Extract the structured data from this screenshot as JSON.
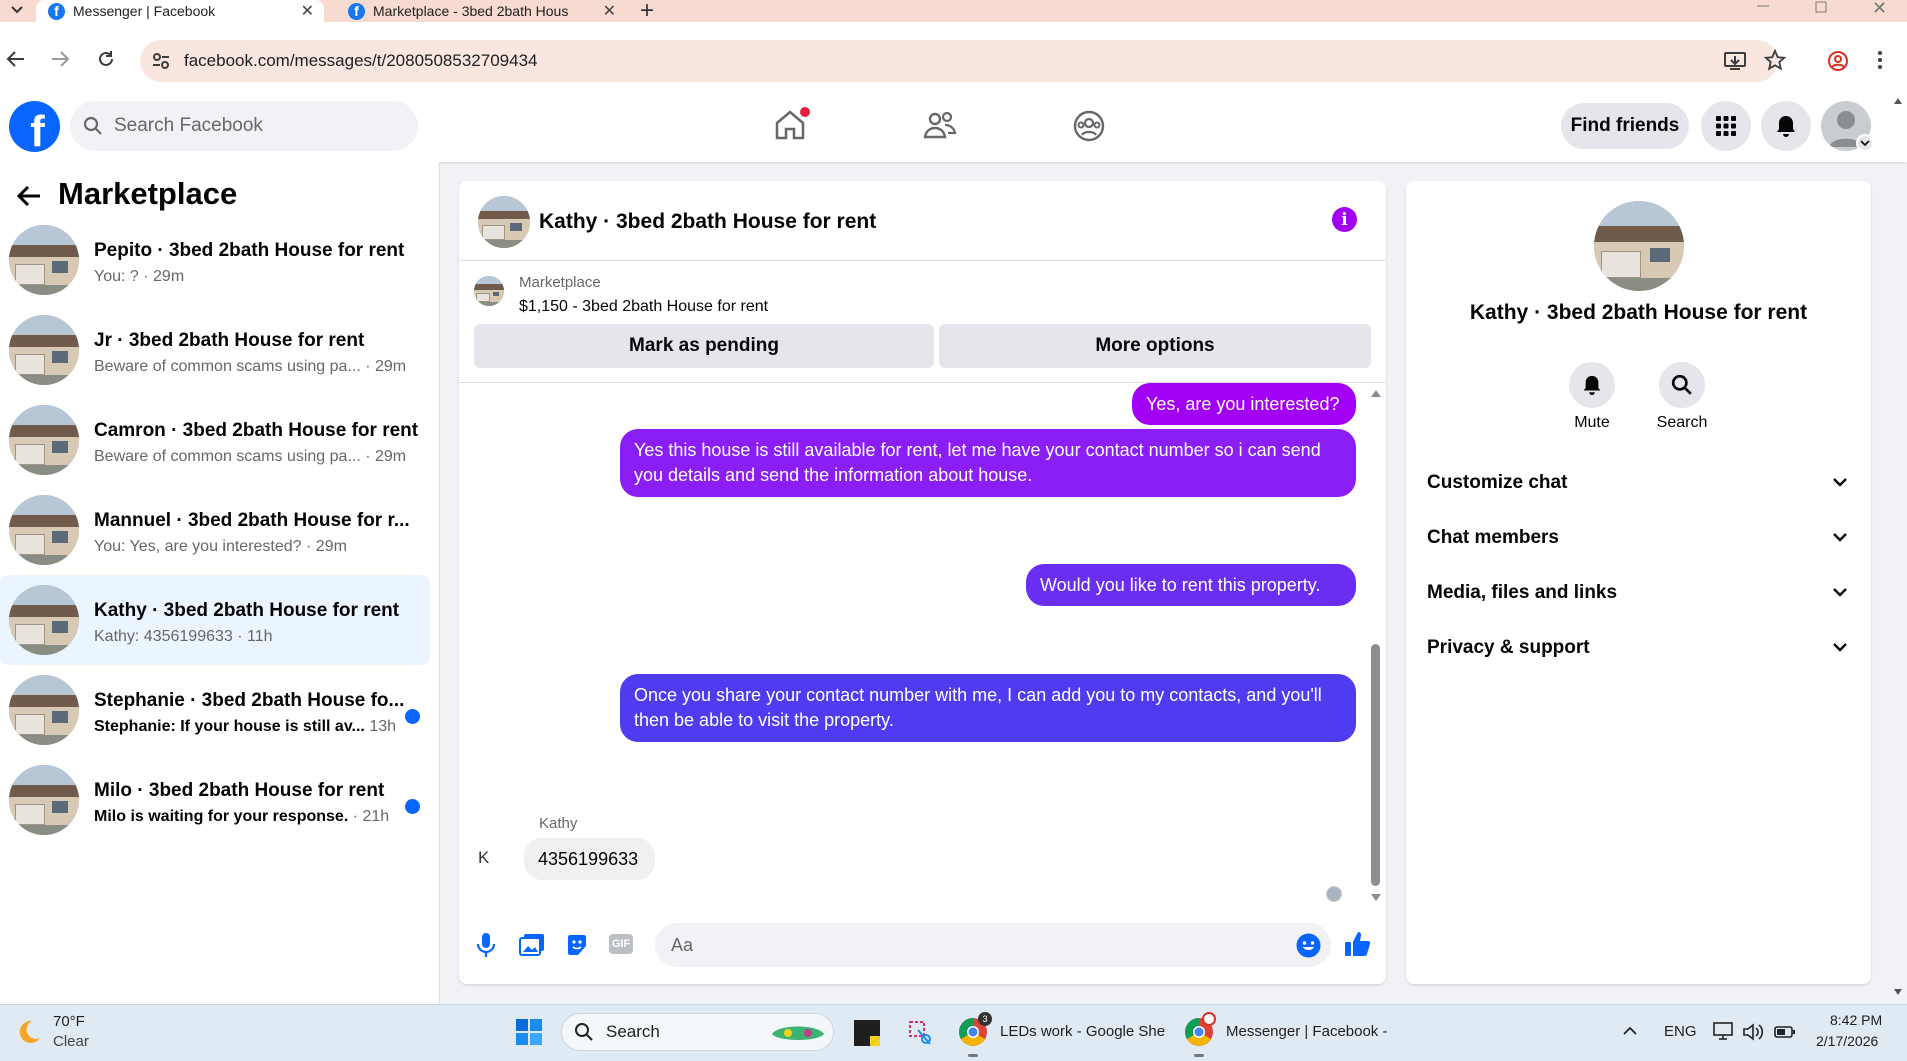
{
  "browser": {
    "tabs": [
      {
        "title": "Messenger | Facebook",
        "active": true
      },
      {
        "title": "Marketplace - 3bed 2bath Hous",
        "active": false
      }
    ],
    "url": "facebook.com/messages/t/2080508532709434"
  },
  "header": {
    "search_placeholder": "Search Facebook",
    "find_friends": "Find friends"
  },
  "sidebar": {
    "title": "Marketplace",
    "conversations": [
      {
        "name": "Pepito · 3bed 2bath House for rent",
        "preview": "You: ?",
        "time": " · 29m",
        "unread": false,
        "selected": false
      },
      {
        "name": "Jr · 3bed 2bath House for rent",
        "preview": "Beware of common scams using pa...",
        "time": " · 29m",
        "unread": false,
        "selected": false
      },
      {
        "name": "Camron · 3bed 2bath House for rent",
        "preview": "Beware of common scams using pa...",
        "time": " · 29m",
        "unread": false,
        "selected": false
      },
      {
        "name": "Mannuel · 3bed 2bath House for r...",
        "preview": "You: Yes, are you interested?",
        "time": " · 29m",
        "unread": false,
        "selected": false
      },
      {
        "name": "Kathy · 3bed 2bath House for rent",
        "preview": "Kathy: 4356199633",
        "time": " · 11h",
        "unread": false,
        "selected": true
      },
      {
        "name": "Stephanie · 3bed 2bath House fo...",
        "preview": "Stephanie: If your house is still av...",
        "time": " 13h",
        "unread": true,
        "selected": false
      },
      {
        "name": "Milo · 3bed 2bath House for rent",
        "preview": "Milo is waiting for your response.",
        "time": " · 21h",
        "unread": true,
        "selected": false
      }
    ]
  },
  "chat": {
    "title": "Kathy · 3bed 2bath House for rent",
    "listing_label": "Marketplace",
    "listing_title": "$1,150 - 3bed 2bath House for rent",
    "mark_pending": "Mark as pending",
    "more_options": "More options",
    "messages": [
      {
        "from": "me",
        "text": "Yes, are you interested?"
      },
      {
        "from": "me",
        "text": "Yes this house is still available for rent, let me have your contact number so i can send you details and send the information about house."
      },
      {
        "from": "me",
        "text": "Would you like to rent this property."
      },
      {
        "from": "me",
        "text": "Once you share your contact number with me, I can add you to my contacts, and you'll then be able to visit the property."
      },
      {
        "from": "Kathy",
        "sender_label": "Kathy",
        "avatar_alt": "K",
        "text": "4356199633"
      }
    ],
    "composer_placeholder": "Aa"
  },
  "details": {
    "name": "Kathy · 3bed 2bath House for rent",
    "mute": "Mute",
    "search": "Search",
    "sections": [
      "Customize chat",
      "Chat members",
      "Media, files and links",
      "Privacy & support"
    ]
  },
  "taskbar": {
    "weather_temp": "70°F",
    "weather_desc": "Clear",
    "search": "Search",
    "app1": "LEDs work - Google She",
    "app2": "Messenger | Facebook -",
    "lang": "ENG",
    "time": "8:42 PM",
    "date": "2/17/2026"
  },
  "colors": {
    "brand": "#0866ff",
    "purple": "#a200f5",
    "indigo": "#4f3cf0"
  }
}
